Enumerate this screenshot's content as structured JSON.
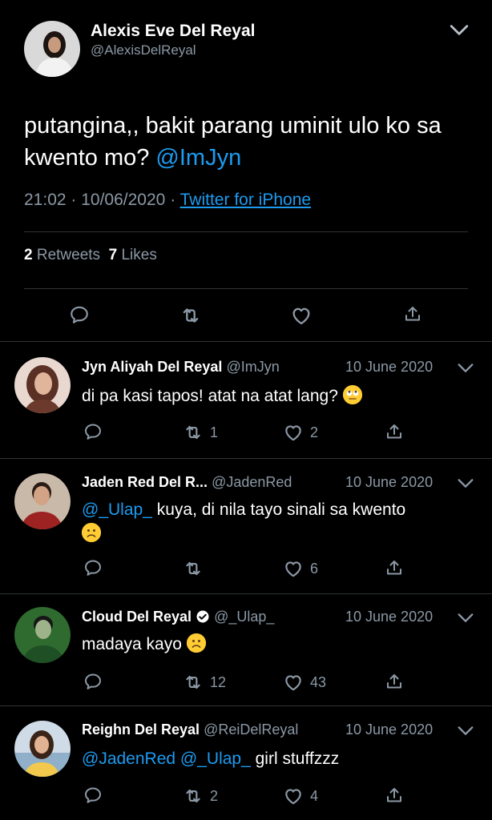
{
  "main_tweet": {
    "author_name": "Alexis Eve Del Reyal",
    "author_handle": "@AlexisDelReyal",
    "text": "putangina,, bakit parang uminit ulo ko sa kwento mo?",
    "mention": "@ImJyn",
    "time": "21:02",
    "date": "10/06/2020",
    "source": "Twitter for iPhone",
    "retweet_count": "2",
    "retweets_label": "Retweets",
    "like_count": "7",
    "likes_label": "Likes"
  },
  "replies": [
    {
      "name": "Jyn Aliyah Del Reyal",
      "handle": "@ImJyn",
      "date": "10 June 2020",
      "text": "di pa kasi tapos! atat na atat lang?",
      "retweets": "1",
      "likes": "2"
    },
    {
      "name": "Jaden Red Del R...",
      "handle": "@JadenRed",
      "date": "10 June 2020",
      "mention": "@_Ulap_",
      "text": "kuya, di nila tayo sinali sa kwento",
      "retweets": "",
      "likes": "6"
    },
    {
      "name": "Cloud Del Reyal",
      "handle": "@_Ulap_",
      "date": "10 June 2020",
      "text": "madaya kayo",
      "retweets": "12",
      "likes": "43"
    },
    {
      "name": "Reighn Del Reyal",
      "handle": "@ReiDelReyal",
      "date": "10 June 2020",
      "mention1": "@JadenRed",
      "mention2": "@_Ulap_",
      "text": "girl stuffzzz",
      "retweets": "2",
      "likes": "4"
    }
  ],
  "icons": {
    "reply": "reply-icon",
    "retweet": "retweet-icon",
    "like": "heart-icon",
    "share": "share-icon",
    "more": "chevron-down-icon",
    "verified": "verified-icon"
  },
  "colors": {
    "background": "#000000",
    "link": "#1d9bf0",
    "secondary_text": "#8b98a5",
    "divider": "#2f3336"
  }
}
